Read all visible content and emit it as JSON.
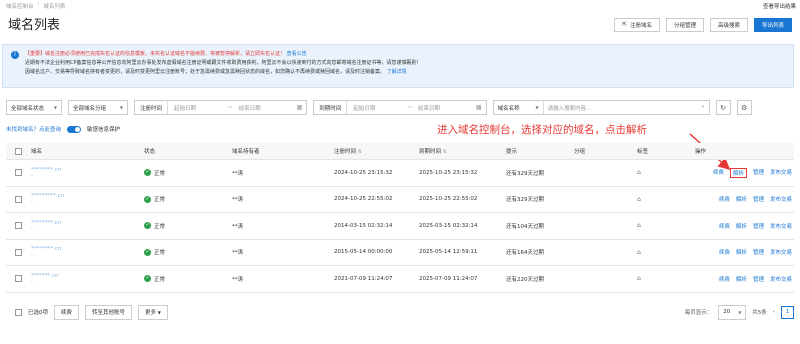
{
  "breadcrumb": [
    "域名控制台",
    "域名列表"
  ],
  "top_right": "查看导出结果",
  "page_title": "域名列表",
  "header_buttons": {
    "register": "注册域名",
    "group": "分组管理",
    "advanced": "高级搜索",
    "export": "导出列表"
  },
  "notice": {
    "tag": "【重要】",
    "line1_red": "域名注册必须使用已完成实名认证的信息模板，未实名认证域名不能续费、将被暂停解析，请立即实名认证！",
    "line1_link": "查看公告",
    "line2": "近期有不法企业利用CP备案信息等公开信息向阿里云办事处发布虚假域名注册证明或跟文件收取费用获利，阿里云不会以快递到付的方式向您邮寄域名注册证书等，请您谨慎甄别！",
    "line3": "因域名过户、交易等导致域名持有者变更的，请及时变更阿里云注册账号；处于急需续费或急需赎回状态的域名，如您确认不再续费或赎回域名，请及时注销备案。",
    "line3_link": "了解详情"
  },
  "filters": {
    "status": "全部域名状态",
    "type": "全部域名分组",
    "reg_label": "注册时间",
    "exp_label": "到期时间",
    "start_ph": "起始日期",
    "end_ph": "结束日期",
    "tilde": "~",
    "search_field": "域名名称",
    "search_ph": "请输入搜索内容..."
  },
  "subline": {
    "hint": "未找到域名？点此查询",
    "toggle_label": "敏感信息保护"
  },
  "annotation": "进入域名控制台，选择对应的域名，点击解析",
  "columns": {
    "name": "域名",
    "status": "状态",
    "owner": "域名持有者",
    "reg": "注册时间",
    "exp": "到期时间",
    "tip": "提示",
    "group": "分组",
    "tag": "标签",
    "ops": "操作",
    "sort": "⇅"
  },
  "rows": [
    {
      "name": "********.cn",
      "sub": "-",
      "status": "正常",
      "owner": "**涛",
      "reg": "2024-10-25 23:15:32",
      "exp": "2025-10-25 23:15:32",
      "tip": "还有329天过期"
    },
    {
      "name": "*********.cn",
      "sub": "-",
      "status": "正常",
      "owner": "**涛",
      "reg": "2024-10-25 22:55:02",
      "exp": "2025-10-25 22:55:02",
      "tip": "还有329天过期"
    },
    {
      "name": "********.cn",
      "sub": "-",
      "status": "正常",
      "owner": "**涛",
      "reg": "2014-03-15 02:32:14",
      "exp": "2025-03-15 02:32:14",
      "tip": "还有104天过期"
    },
    {
      "name": "********.cn",
      "sub": "-",
      "status": "正常",
      "owner": "**涛",
      "reg": "2015-05-14 00:00:00",
      "exp": "2025-05-14 12:59:11",
      "tip": "还有164天过期"
    },
    {
      "name": "*******.cn",
      "sub": "-",
      "status": "正常",
      "owner": "**涛",
      "reg": "2021-07-09 11:24:07",
      "exp": "2025-07-09 11:24:07",
      "tip": "还有220天过期"
    }
  ],
  "ops": {
    "renew": "续费",
    "resolve": "解析",
    "manage": "管理",
    "sell": "发布交易"
  },
  "footer": {
    "selected": "已选0项",
    "renew": "续费",
    "transfer": "转至其他账号",
    "more": "更多",
    "per_page_label": "每页显示：",
    "per_page": "20",
    "total": "共5条",
    "page": "1"
  }
}
